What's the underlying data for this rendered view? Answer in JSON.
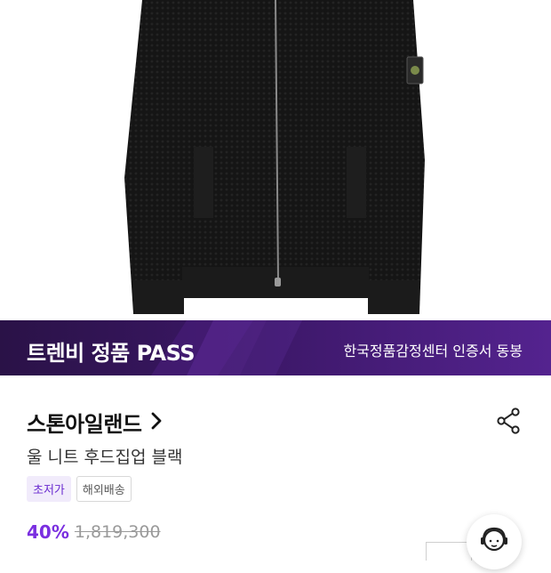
{
  "banner": {
    "title": "트렌비 정품 PASS",
    "subtitle": "한국정품감정센터 인증서 동봉"
  },
  "brand": {
    "name": "스톤아일랜드",
    "chevron": "chevron-right-icon"
  },
  "share": {
    "icon": "share-icon"
  },
  "product": {
    "name": "울 니트 후드집업 블랙"
  },
  "tags": [
    "초저가",
    "해외배송"
  ],
  "price": {
    "discount": "40%",
    "original": "1,819,300"
  },
  "support": {
    "icon": "customer-support-icon"
  },
  "colors": {
    "accent": "#7a2fe0",
    "banner_start": "#2a1247",
    "banner_end": "#54238f"
  }
}
